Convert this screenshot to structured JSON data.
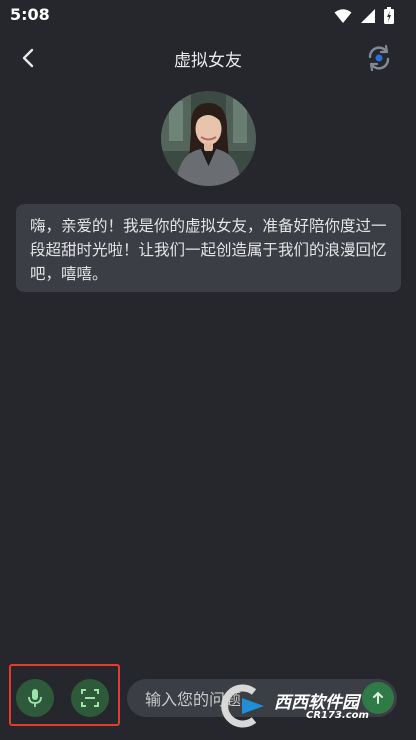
{
  "status_bar": {
    "time": "5:08"
  },
  "header": {
    "title": "虚拟女友"
  },
  "chat": {
    "message": "嗨，亲爱的！我是你的虚拟女友，准备好陪你度过一段超甜时光啦！让我们一起创造属于我们的浪漫回忆吧，嘻嘻。"
  },
  "input": {
    "placeholder": "输入您的问题"
  },
  "watermark": {
    "main": "西西软件园",
    "sub": "CR173.com"
  },
  "colors": {
    "background": "#25272d",
    "bubble": "#3b3e44",
    "accent_green": "#2e5a3b",
    "highlight_red": "#e33b2e"
  }
}
